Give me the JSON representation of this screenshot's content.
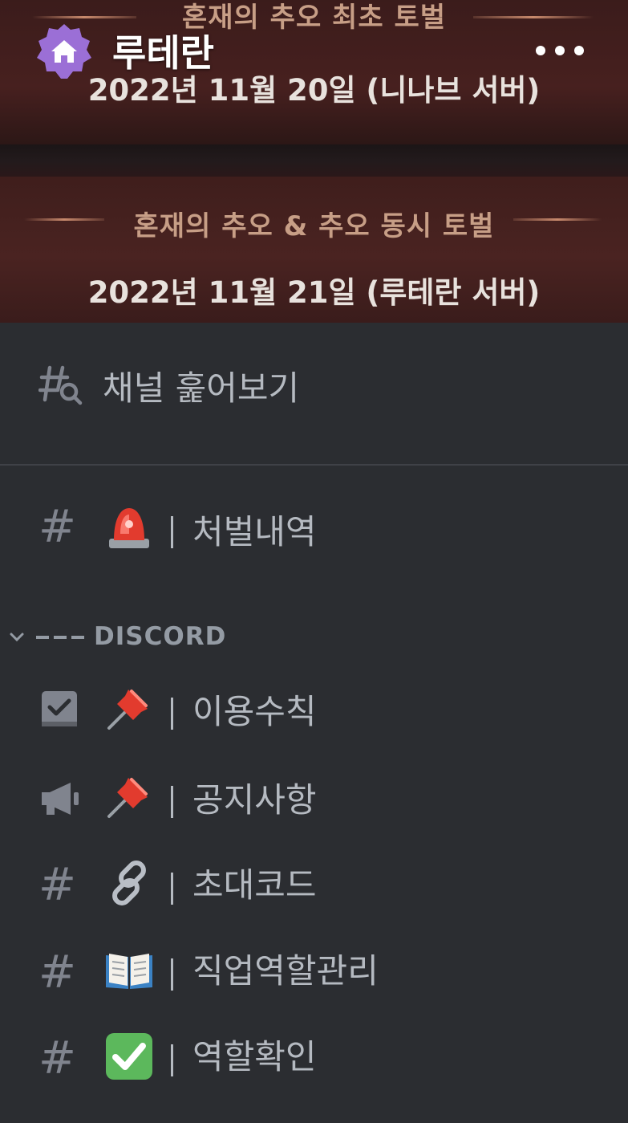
{
  "server": {
    "name": "루테란",
    "icon": "home-icon",
    "more_icon": "more-dots-icon"
  },
  "banner": {
    "line1_title": "혼재의 추오 최초 토벌",
    "line1_date": "2022년 11월 20일 (니나브 서버)",
    "line2_title": "혼재의 추오 & 추오 동시 토벌",
    "line2_date": "2022년 11월 21일 (루테란 서버)"
  },
  "browse_channels": {
    "label": "채널 훑어보기",
    "icon": "browse-channels-icon"
  },
  "channels_top": [
    {
      "icon": "hash-icon",
      "emoji": "rotating-light",
      "label": "처벌내역"
    }
  ],
  "category": {
    "label": "--- DISCORD",
    "icon": "chevron-down-icon"
  },
  "channels": [
    {
      "icon": "rules-icon",
      "emoji": "pushpin",
      "label": "이용수칙"
    },
    {
      "icon": "announcement-icon",
      "emoji": "pushpin",
      "label": "공지사항"
    },
    {
      "icon": "hash-icon",
      "emoji": "link",
      "label": "초대코드"
    },
    {
      "icon": "hash-icon",
      "emoji": "open-book",
      "label": "직업역할관리"
    },
    {
      "icon": "hash-icon",
      "emoji": "check-mark-button",
      "label": "역할확인"
    }
  ],
  "colors": {
    "background": "#2b2d31",
    "text_muted": "#b5bac1",
    "icon_muted": "#80848e",
    "server_icon": "#9b6fd6"
  }
}
